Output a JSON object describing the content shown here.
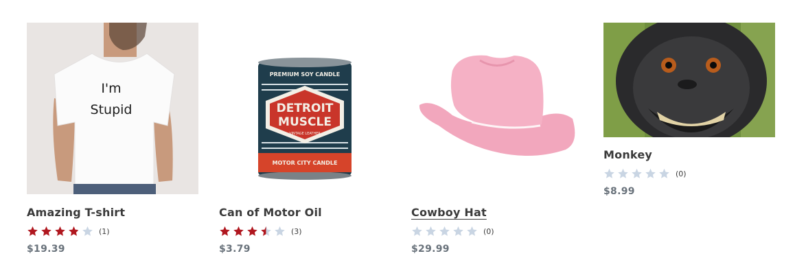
{
  "colors": {
    "star_filled": "#b0171f",
    "star_empty": "#c9d5e3",
    "title": "#3a3a3a",
    "price": "#69727b"
  },
  "products": [
    {
      "title": "Amazing T-shirt",
      "rating": 3.9,
      "review_count": "(1)",
      "price": "$19.39",
      "image": {
        "icon": "t-shirt-photo",
        "shirt_text_line1": "I'm",
        "shirt_text_line2": "Stupid"
      }
    },
    {
      "title": "Can of Motor Oil",
      "rating": 3.5,
      "review_count": "(3)",
      "price": "$3.79",
      "image": {
        "icon": "candle-tin-photo",
        "label_top": "PREMIUM SOY CANDLE",
        "label_main_1": "DETROIT",
        "label_main_2": "MUSCLE",
        "label_sub": "VINTAGE LEATHER",
        "label_bottom": "MOTOR CITY CANDLE"
      }
    },
    {
      "title": "Cowboy Hat",
      "rating": 0,
      "review_count": "(0)",
      "price": "$29.99",
      "image": {
        "icon": "pink-cowboy-hat-photo"
      }
    },
    {
      "title": "Monkey",
      "rating": 0,
      "review_count": "(0)",
      "price": "$8.99",
      "image": {
        "icon": "monkey-selfie-photo"
      }
    }
  ]
}
